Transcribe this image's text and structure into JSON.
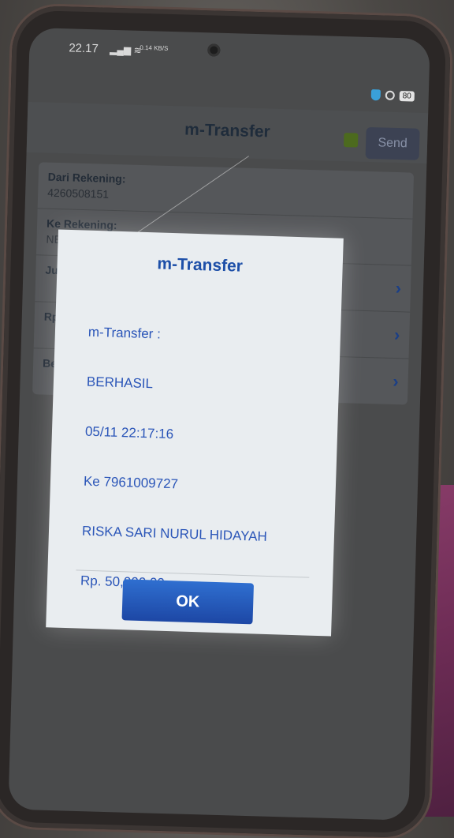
{
  "status": {
    "time": "22.17",
    "net_speed": "0.14\nKB/S",
    "battery": "80"
  },
  "app": {
    "title": "m-Transfer",
    "send_label": "Send"
  },
  "form": {
    "rows": [
      {
        "label": "Dari Rekening:",
        "value": "4260508151"
      },
      {
        "label": "Ke Rekening:",
        "value": "NEW!"
      },
      {
        "label": "Jumla",
        "value": ""
      },
      {
        "label": "Rp",
        "value": ""
      },
      {
        "label": "Berita",
        "value": ""
      }
    ]
  },
  "dialog": {
    "title": "m-Transfer",
    "message_lines": [
      "m-Transfer :",
      "BERHASIL",
      "05/11 22:17:16",
      "Ke 7961009727",
      "RISKA SARI NURUL HIDAYAH",
      "Rp. 50,000.00"
    ],
    "ok_label": "OK"
  },
  "colors": {
    "accent": "#1d4fa8",
    "button": "#2f6fd0"
  }
}
